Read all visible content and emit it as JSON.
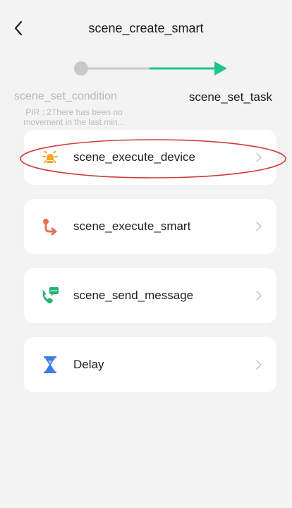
{
  "header": {
    "title": "scene_create_smart",
    "back_icon": "chevron-left-icon"
  },
  "stepper": {
    "active_color": "#1fc58f",
    "inactive_color": "#c8c8c8",
    "steps": [
      {
        "label": "scene_set_condition",
        "sublabel": "PIR : 2There has been no movement in the last min..."
      },
      {
        "label": "scene_set_task"
      }
    ]
  },
  "actions": [
    {
      "label": "scene_execute_device",
      "icon": "lightbulb-icon",
      "icon_color": "#f5a623"
    },
    {
      "label": "scene_execute_smart",
      "icon": "route-icon",
      "icon_color": "#e8705a"
    },
    {
      "label": "scene_send_message",
      "icon": "phone-message-icon",
      "icon_color": "#22b573"
    },
    {
      "label": "Delay",
      "icon": "hourglass-icon",
      "icon_color": "#3b7de0"
    }
  ],
  "annotation": {
    "highlight_color": "#d23a3a"
  }
}
